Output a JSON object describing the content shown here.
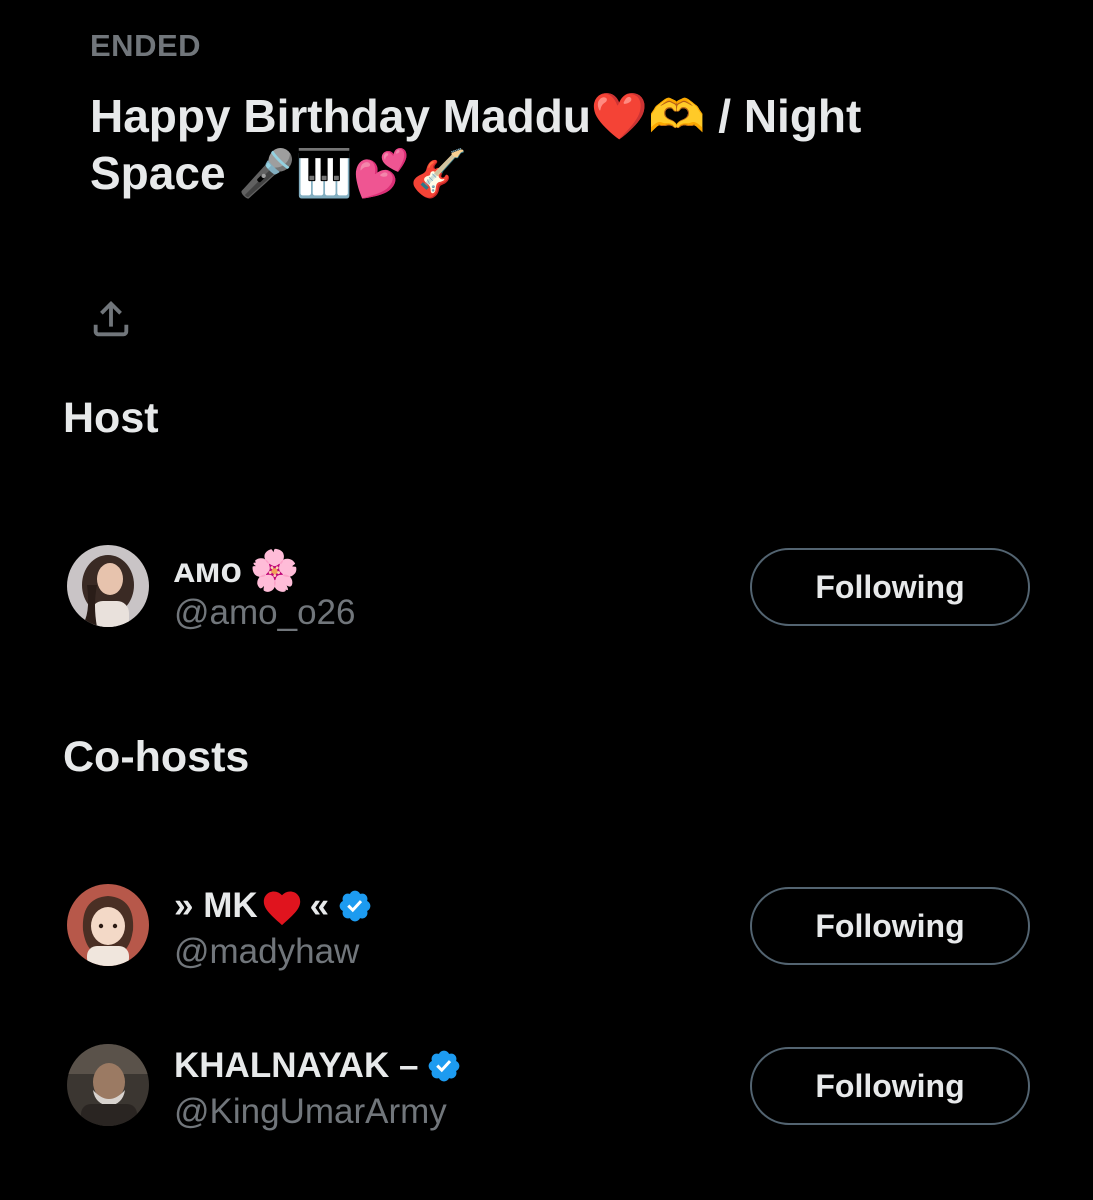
{
  "space": {
    "status": "ENDED",
    "title": "Happy Birthday Maddu❤️🫶 / Night Space 🎤🎹💕🎸"
  },
  "share": {
    "icon": "share-icon"
  },
  "host_section": {
    "heading": "Host",
    "users": [
      {
        "display_name": "ᴀᴍᴏ",
        "name_emoji": "🌸",
        "handle": "@amo_o26",
        "verified": false,
        "button_label": "Following"
      }
    ]
  },
  "cohosts_section": {
    "heading": "Co-hosts",
    "users": [
      {
        "name_prefix": "» MK",
        "name_suffix": "«",
        "handle": "@madyhaw",
        "verified": true,
        "button_label": "Following"
      },
      {
        "display_name": "KHALNAYAK –",
        "handle": "@KingUmarArmy",
        "verified": true,
        "button_label": "Following"
      }
    ]
  },
  "colors": {
    "background": "#000000",
    "primary_text": "#e7e9ea",
    "secondary_text": "#71767b",
    "button_border": "#536471",
    "verified_blue": "#1d9bf0",
    "heart_red": "#e0141e"
  }
}
